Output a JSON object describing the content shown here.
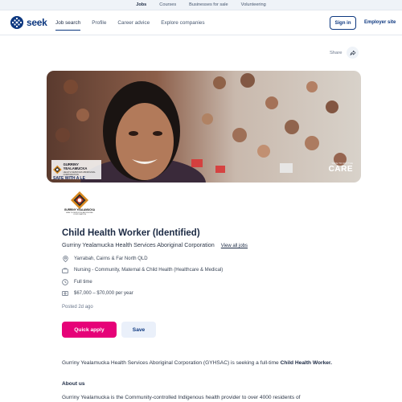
{
  "top_links": [
    "Jobs",
    "Courses",
    "Businesses for sale",
    "Volunteering"
  ],
  "nav": {
    "logo_text": "seek",
    "links": [
      "Job search",
      "Profile",
      "Career advice",
      "Explore companies"
    ],
    "sign_in": "Sign in",
    "employer_site": "Employer site"
  },
  "share_label": "Share",
  "banner": {
    "logo_name": "GURRINY YEALAMUCKA",
    "logo_sub": "HEALTH SERVICES ABORIGINAL CORPORATION",
    "safe_text": "SAFE WITH A LE",
    "care_small": "SAFE TO GET THE",
    "care_big": "CARE"
  },
  "company_logo": {
    "name": "GURRINY YEALAMUCKA",
    "sub": "HEALTH SERVICES ABORIGINAL CORPORATION"
  },
  "job": {
    "title": "Child Health Worker (Identified)",
    "company": "Gurriny Yealamucka Health Services Aboriginal Corporation",
    "view_all": "View all jobs",
    "location": "Yarrabah, Cairns & Far North QLD",
    "category": "Nursing - Community, Maternal & Child Health (Healthcare & Medical)",
    "work_type": "Full time",
    "salary": "$67,000 – $70,000 per year",
    "posted": "Posted 2d ago",
    "icons": [
      "location-pin-icon",
      "briefcase-icon",
      "clock-icon",
      "money-icon"
    ]
  },
  "actions": {
    "apply": "Quick apply",
    "save": "Save"
  },
  "description": {
    "intro_lead": "Gurriny Yealamucka Health Services Aboriginal Corporation (GYHSAC) is seeking a full-time",
    "intro_role": "Child Health Worker.",
    "about_heading": "About us",
    "about_text": "Gurriny Yealamucka is the Community-controlled Indigenous health provider to over 4000 residents of"
  },
  "colors": {
    "brand": "#0d3880",
    "apply": "#e60278",
    "save_bg": "#eaf0fa"
  }
}
